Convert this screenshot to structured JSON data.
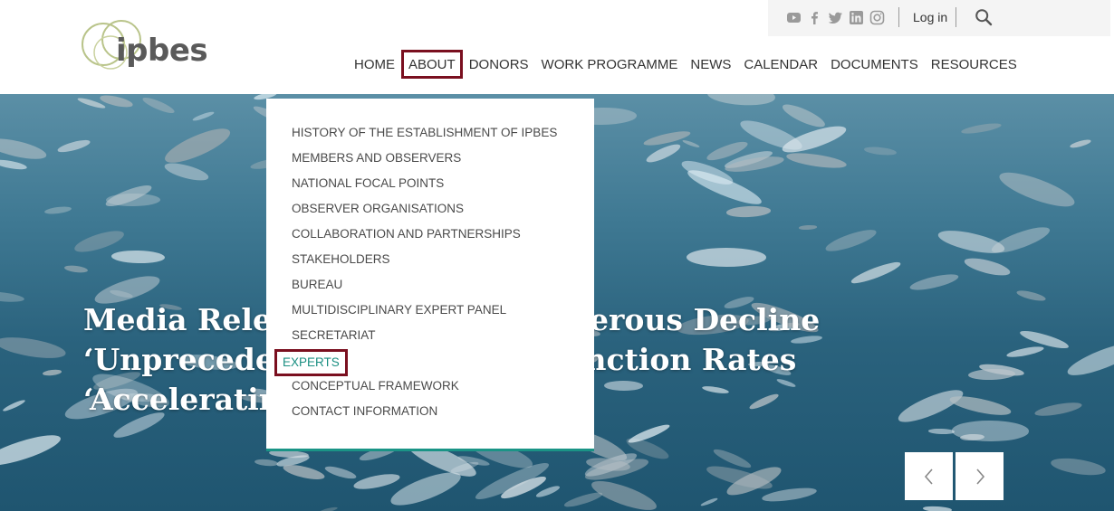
{
  "header": {
    "logo_text": "ipbes",
    "login_label": "Log in",
    "social_icons": [
      "youtube-icon",
      "facebook-icon",
      "twitter-icon",
      "linkedin-icon",
      "instagram-icon"
    ]
  },
  "nav": {
    "items": [
      "HOME",
      "ABOUT",
      "DONORS",
      "WORK PROGRAMME",
      "NEWS",
      "CALENDAR",
      "DOCUMENTS",
      "RESOURCES"
    ],
    "highlighted": "ABOUT"
  },
  "dropdown": {
    "items": [
      "HISTORY OF THE ESTABLISHMENT OF IPBES",
      "MEMBERS AND OBSERVERS",
      "NATIONAL FOCAL POINTS",
      "OBSERVER ORGANISATIONS",
      "COLLABORATION AND PARTNERSHIPS",
      "STAKEHOLDERS",
      "BUREAU",
      "MULTIDISCIPLINARY EXPERT PANEL",
      "SECRETARIAT",
      "EXPERTS",
      "CONCEPTUAL FRAMEWORK",
      "CONTACT INFORMATION"
    ],
    "active": "EXPERTS"
  },
  "hero": {
    "title_line1": "Media Release: Nature's Dangerous Decline",
    "title_line2": "‘Unprecedented’; Species Extinction Rates ‘Accelerating’"
  },
  "colors": {
    "highlight_border": "#7a0f1f",
    "active_link": "#1a8f82",
    "dropdown_accent": "#1a9486"
  }
}
